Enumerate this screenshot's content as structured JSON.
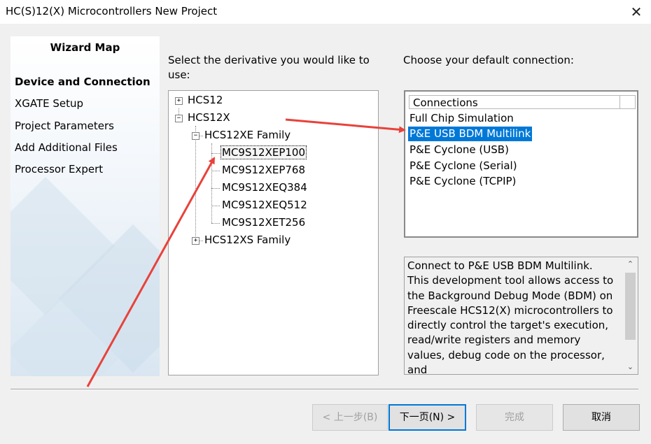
{
  "window": {
    "title": "HC(S)12(X) Microcontrollers New Project",
    "close_icon": "close-icon"
  },
  "wizard_map": {
    "heading": "Wizard Map",
    "items": [
      {
        "label": "Device and Connection",
        "active": true
      },
      {
        "label": "XGATE Setup"
      },
      {
        "label": "Project Parameters"
      },
      {
        "label": "Add Additional Files"
      },
      {
        "label": "Processor Expert"
      }
    ]
  },
  "derivative": {
    "prompt": "Select the derivative you would like to use:",
    "tree": {
      "hcs12": "HCS12",
      "hcs12x": "HCS12X",
      "hcs12xe_family": "HCS12XE Family",
      "devices": [
        "MC9S12XEP100",
        "MC9S12XEP768",
        "MC9S12XEQ384",
        "MC9S12XEQ512",
        "MC9S12XET256"
      ],
      "hcs12xs_family": "HCS12XS Family"
    },
    "selected": "MC9S12XEP100"
  },
  "connection": {
    "prompt": "Choose your default connection:",
    "column_header": "Connections",
    "items": [
      "Full Chip Simulation",
      "P&E USB BDM Multilink",
      "P&E Cyclone (USB)",
      "P&E Cyclone (Serial)",
      "P&E Cyclone (TCPIP)"
    ],
    "selected": "P&E USB BDM Multilink",
    "description": "Connect to P&E USB BDM Multilink. This development tool allows access to the Background Debug Mode (BDM) on Freescale HCS12(X) microcontrollers to directly control the target's execution, read/write registers and memory values, debug code on the processor, and"
  },
  "buttons": {
    "back": "< 上一步(B)",
    "next": "下一页(N) >",
    "finish": "完成",
    "cancel": "取消"
  },
  "colors": {
    "selection": "#0078d7",
    "annotation_arrow": "#e8423b"
  }
}
